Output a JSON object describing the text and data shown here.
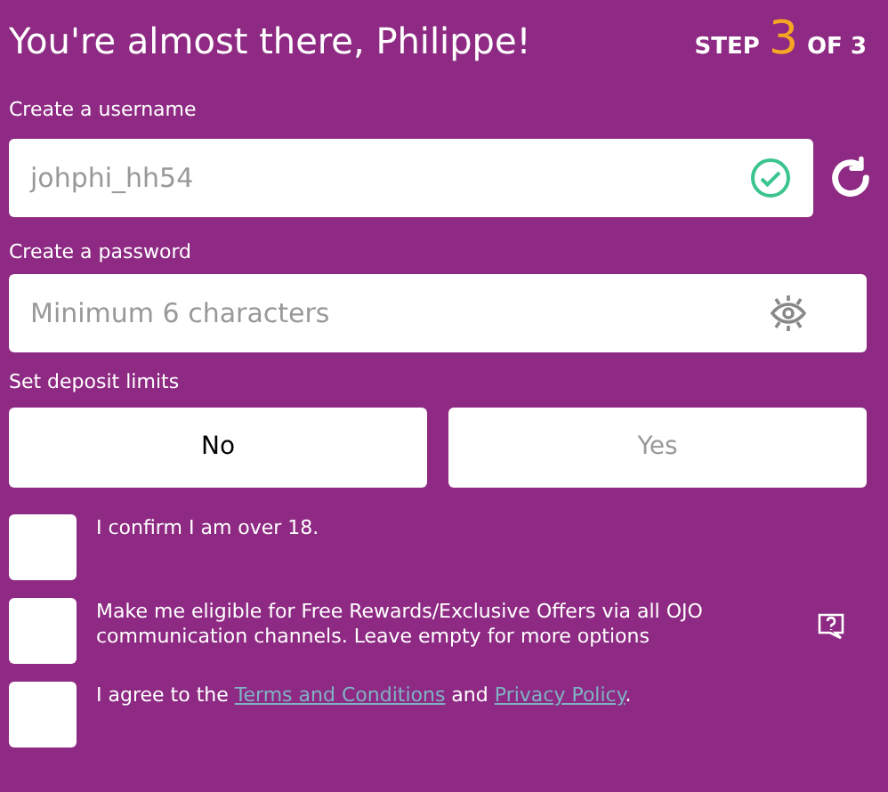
{
  "header": {
    "title": "You're almost there, Philippe!",
    "step_label": "STEP",
    "step_current": "3",
    "step_total": "OF 3"
  },
  "username": {
    "label": "Create a username",
    "value": "johphi_hh54",
    "valid": true
  },
  "password": {
    "label": "Create a password",
    "placeholder": "Minimum 6 characters"
  },
  "deposit_limits": {
    "label": "Set deposit limits",
    "options": [
      {
        "label": "No",
        "selected": true
      },
      {
        "label": "Yes",
        "selected": false
      }
    ]
  },
  "checkboxes": [
    {
      "checked": false,
      "help": false,
      "parts": [
        {
          "kind": "text",
          "text": "I confirm I am over 18."
        }
      ]
    },
    {
      "checked": false,
      "help": true,
      "parts": [
        {
          "kind": "text",
          "text": "Make me eligible for Free Rewards/Exclusive Offers via all OJO communication channels. Leave empty for more options"
        }
      ]
    },
    {
      "checked": false,
      "help": false,
      "parts": [
        {
          "kind": "text",
          "text": "I agree to the "
        },
        {
          "kind": "link",
          "text": "Terms and Conditions"
        },
        {
          "kind": "text",
          "text": " and "
        },
        {
          "kind": "link",
          "text": "Privacy Policy"
        },
        {
          "kind": "text",
          "text": "."
        }
      ]
    }
  ]
}
